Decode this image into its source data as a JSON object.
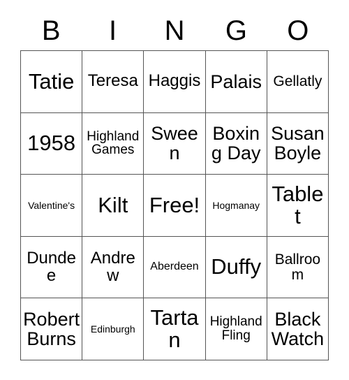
{
  "card": {
    "title": "BINGO",
    "header_letters": [
      "B",
      "I",
      "N",
      "G",
      "O"
    ],
    "free_space_label": "Free!",
    "colors": {
      "background": "#ffffff",
      "text": "#000000",
      "grid_line": "#555555"
    },
    "columns": 5,
    "rows": 5,
    "rows_data": [
      {
        "letter": "B",
        "cells": [
          {
            "text": "Tatie",
            "size": "fs-xxl"
          },
          {
            "text": "Teresa",
            "size": "fs-lg"
          },
          {
            "text": "Haggis",
            "size": "fs-lg"
          },
          {
            "text": "Palais",
            "size": "fs-xl"
          },
          {
            "text": "Gellatly",
            "size": "fs-md"
          }
        ]
      },
      {
        "letter": "I",
        "cells": [
          {
            "text": "1958",
            "size": "fs-xxl"
          },
          {
            "text": "Highland Games",
            "size": "fs-sm"
          },
          {
            "text": "Sween",
            "size": "fs-xl"
          },
          {
            "text": "Boxing Day",
            "size": "fs-xl"
          },
          {
            "text": "Susan Boyle",
            "size": "fs-xl"
          }
        ]
      },
      {
        "letter": "N",
        "cells": [
          {
            "text": "Valentine's",
            "size": "fs-xxs"
          },
          {
            "text": "Kilt",
            "size": "fs-xxl"
          },
          {
            "text": "Free!",
            "size": "fs-xxl"
          },
          {
            "text": "Hogmanay",
            "size": "fs-xxs"
          },
          {
            "text": "Tablet",
            "size": "fs-xxl"
          }
        ]
      },
      {
        "letter": "G",
        "cells": [
          {
            "text": "Dundee",
            "size": "fs-lg"
          },
          {
            "text": "Andrew",
            "size": "fs-lg"
          },
          {
            "text": "Aberdeen",
            "size": "fs-xs"
          },
          {
            "text": "Duffy",
            "size": "fs-xxl"
          },
          {
            "text": "Ballroom",
            "size": "fs-md"
          }
        ]
      },
      {
        "letter": "O",
        "cells": [
          {
            "text": "Robert Burns",
            "size": "fs-xl"
          },
          {
            "text": "Edinburgh",
            "size": "fs-xxs"
          },
          {
            "text": "Tartan",
            "size": "fs-xxl"
          },
          {
            "text": "Highland Fling",
            "size": "fs-sm"
          },
          {
            "text": "Black Watch",
            "size": "fs-xl"
          }
        ]
      }
    ]
  }
}
